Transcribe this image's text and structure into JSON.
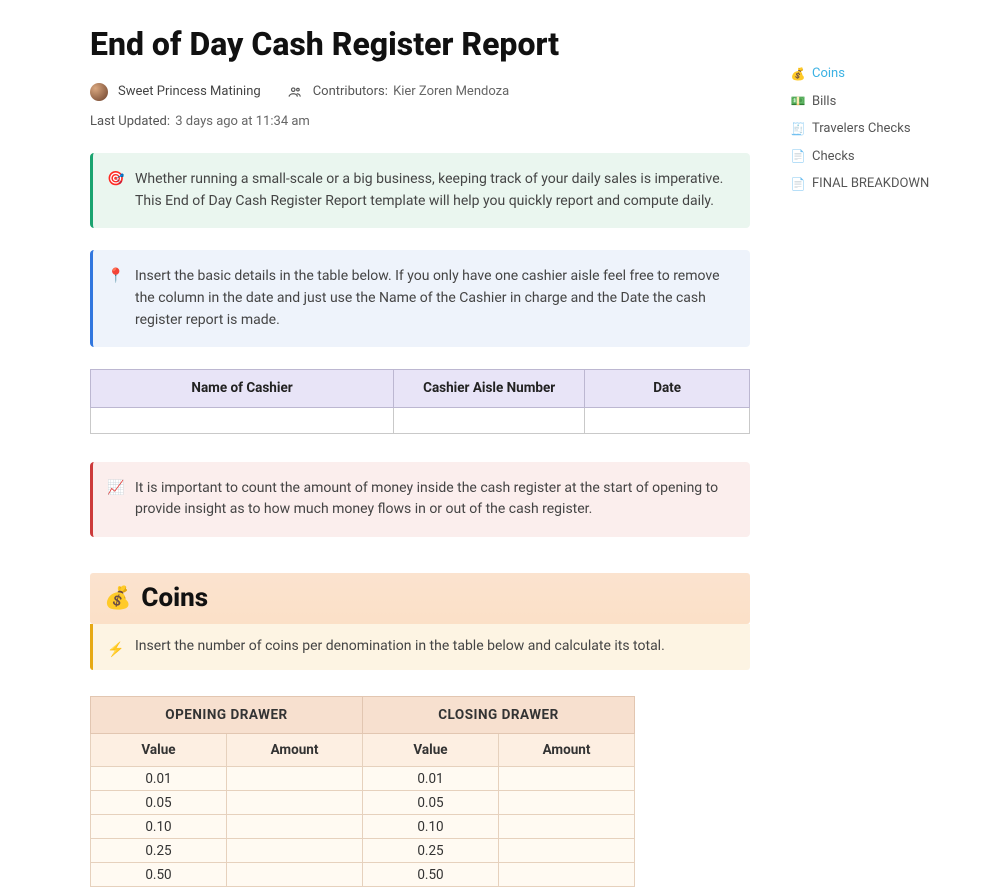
{
  "title": "End of Day Cash Register Report",
  "meta": {
    "author": "Sweet Princess Matining",
    "contributors_label": "Contributors:",
    "contributors": "Kier Zoren Mendoza",
    "last_updated_label": "Last Updated:",
    "last_updated": "3 days ago at 11:34 am"
  },
  "callouts": {
    "intro": {
      "icon": "🎯",
      "text": "Whether running a small-scale or a big business, keeping track of your daily sales is imperative. This End of Day Cash Register Report template will help you quickly report and compute daily."
    },
    "details_hint": {
      "icon": "📍",
      "text": "Insert the basic details in the table below. If you only have one cashier aisle feel free to remove the column in the date and just use the Name of the Cashier in charge and the Date the cash register report is made."
    },
    "count_hint": {
      "icon": "📈",
      "text": " It is important to count the amount of money inside the cash register at the start of opening to provide insight as to how much money flows in or out of the cash register."
    },
    "coins_hint": {
      "icon": "⚡",
      "text": "Insert the number of coins per denomination in the table below and calculate its total."
    }
  },
  "cashier_table": {
    "headers": [
      "Name of Cashier",
      "Cashier Aisle Number",
      "Date"
    ]
  },
  "coins_section": {
    "icon": "💰",
    "heading": "Coins"
  },
  "coins_table": {
    "group_headers": [
      "OPENING DRAWER",
      "CLOSING DRAWER"
    ],
    "sub_headers": [
      "Value",
      "Amount",
      "Value",
      "Amount"
    ],
    "rows": [
      {
        "open_value": "0.01",
        "open_amount": "",
        "close_value": "0.01",
        "close_amount": ""
      },
      {
        "open_value": "0.05",
        "open_amount": "",
        "close_value": "0.05",
        "close_amount": ""
      },
      {
        "open_value": "0.10",
        "open_amount": "",
        "close_value": "0.10",
        "close_amount": ""
      },
      {
        "open_value": "0.25",
        "open_amount": "",
        "close_value": "0.25",
        "close_amount": ""
      },
      {
        "open_value": "0.50",
        "open_amount": "",
        "close_value": "0.50",
        "close_amount": ""
      }
    ]
  },
  "toc": [
    {
      "icon": "💰",
      "label": "Coins",
      "active": true
    },
    {
      "icon": "💵",
      "label": "Bills",
      "active": false
    },
    {
      "icon": "🧾",
      "label": "Travelers Checks",
      "active": false
    },
    {
      "icon": "📄",
      "label": "Checks",
      "active": false
    },
    {
      "icon": "📄",
      "label": "FINAL BREAKDOWN",
      "active": false
    }
  ]
}
